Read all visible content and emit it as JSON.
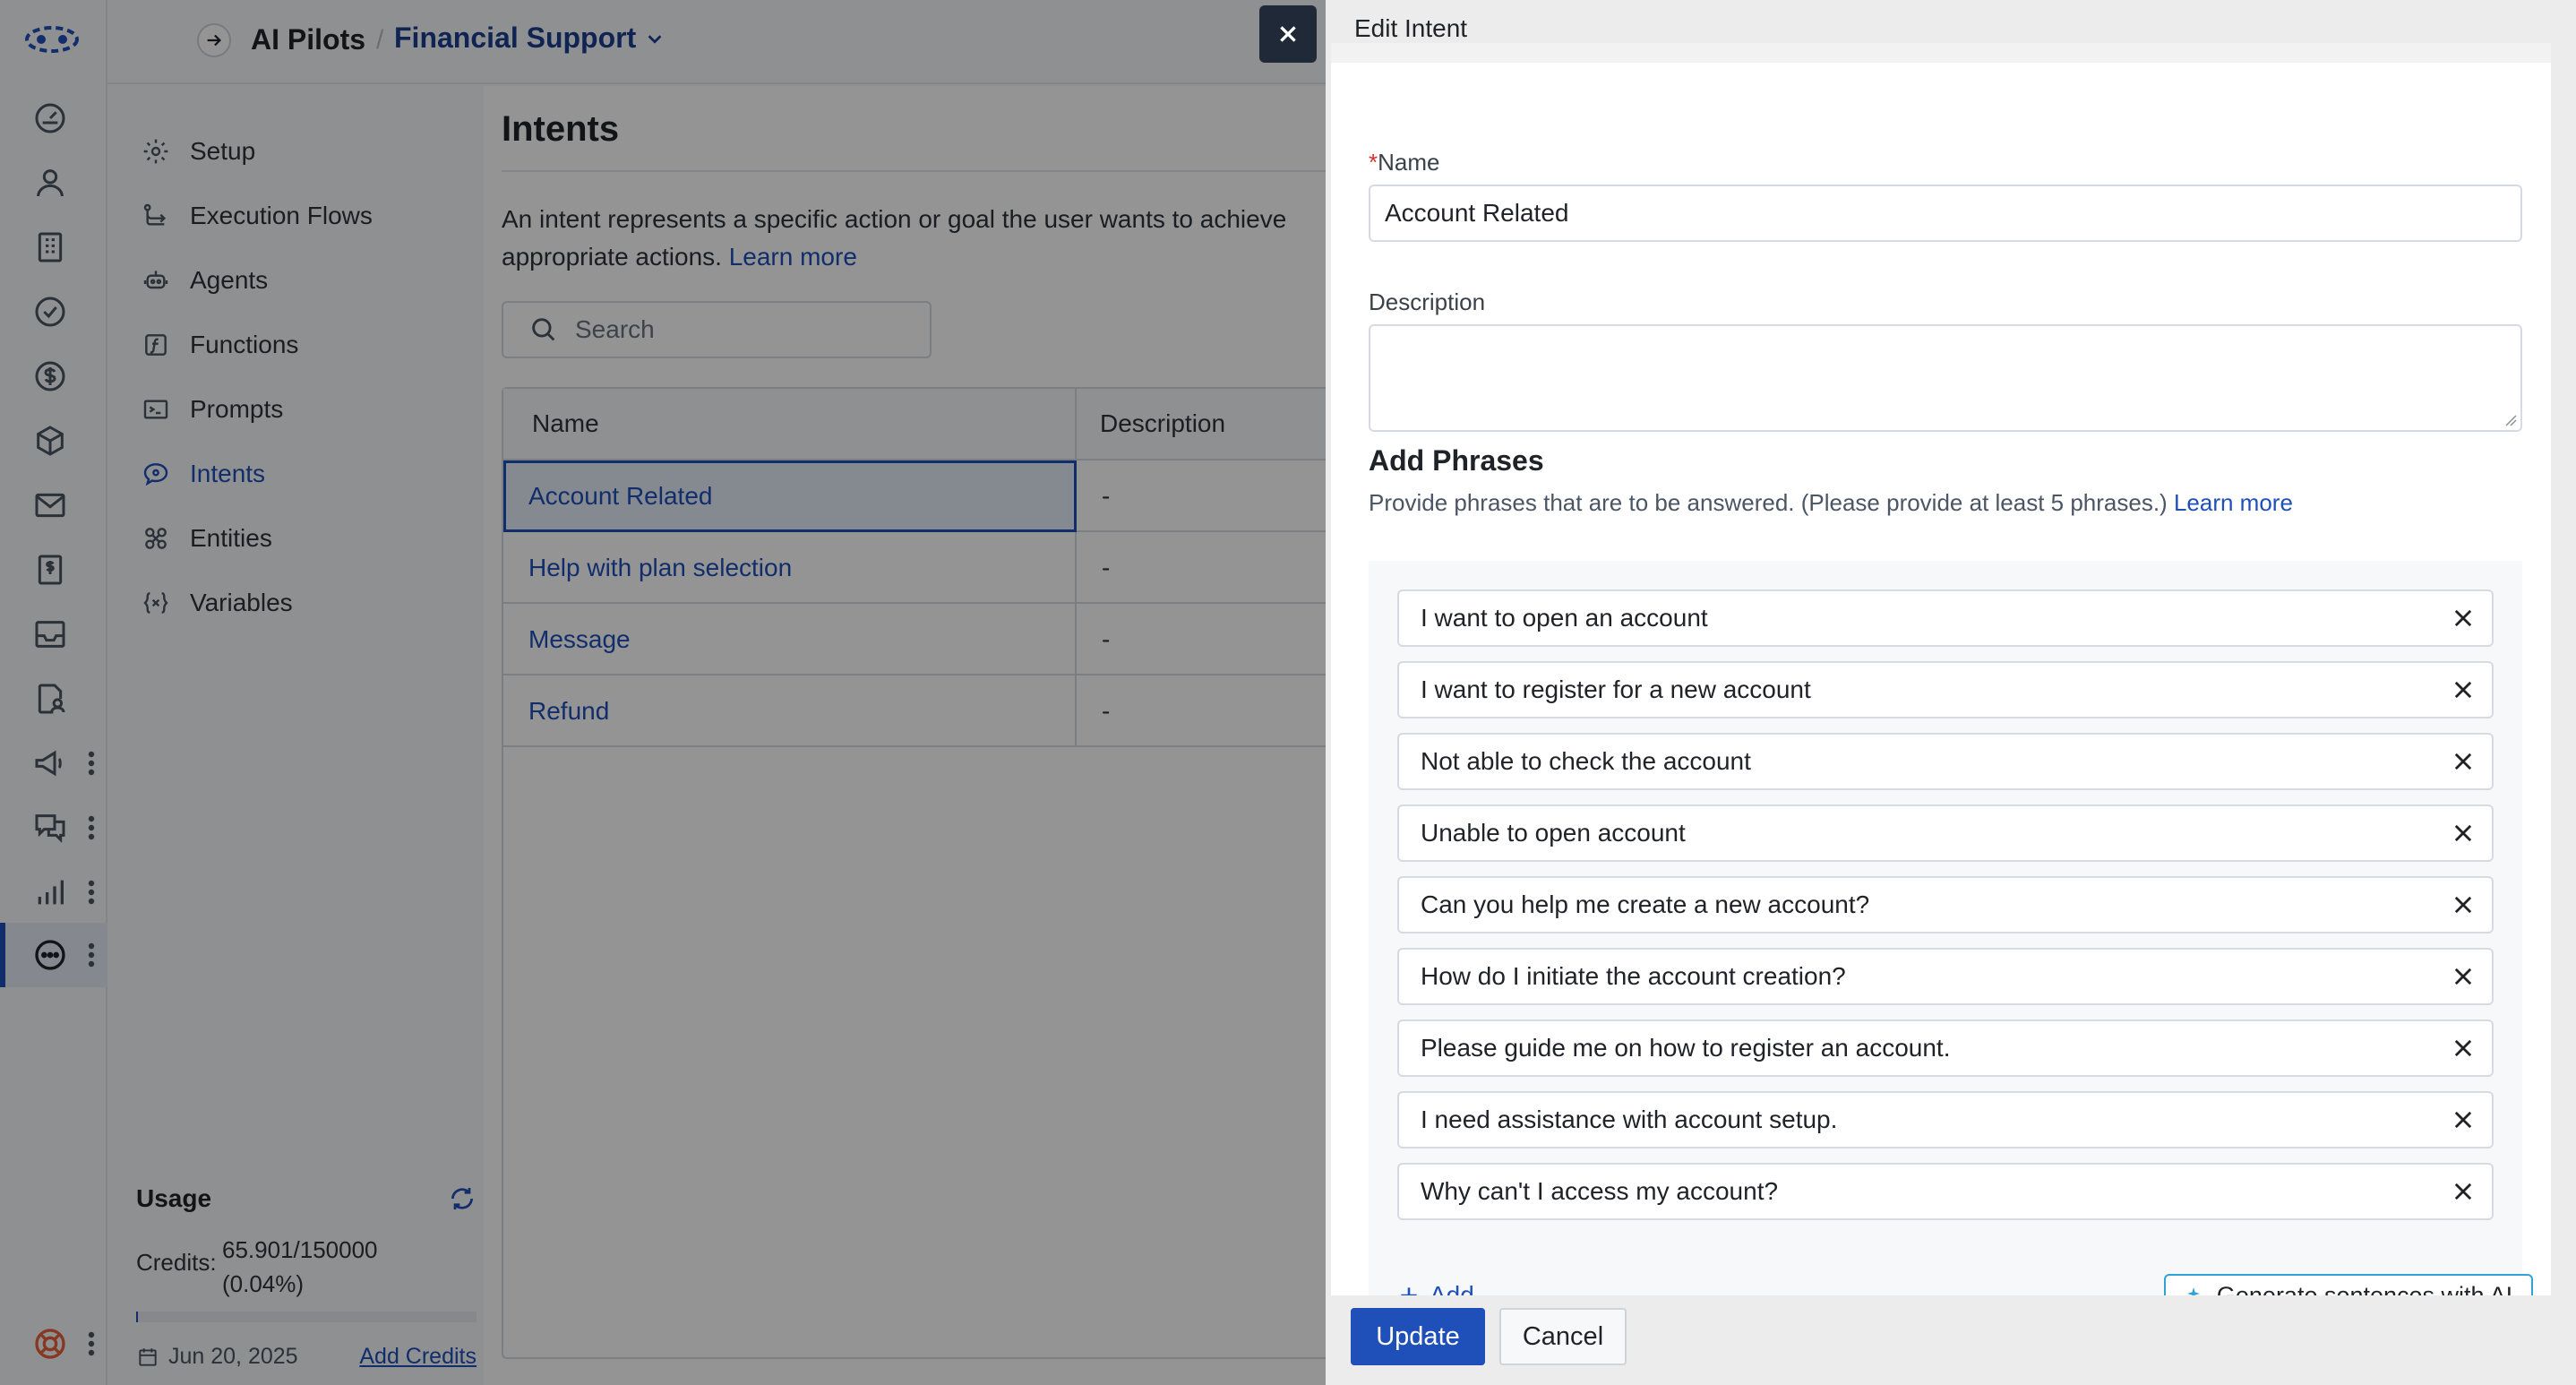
{
  "header": {
    "brand": "AI Pilots",
    "separator": "/",
    "project": "Financial Support"
  },
  "subnav": {
    "items": [
      {
        "label": "Setup",
        "icon": "gear-icon"
      },
      {
        "label": "Execution Flows",
        "icon": "flow-icon"
      },
      {
        "label": "Agents",
        "icon": "agent-icon"
      },
      {
        "label": "Functions",
        "icon": "function-icon"
      },
      {
        "label": "Prompts",
        "icon": "prompt-icon"
      },
      {
        "label": "Intents",
        "icon": "intent-icon",
        "active": true
      },
      {
        "label": "Entities",
        "icon": "entity-icon"
      },
      {
        "label": "Variables",
        "icon": "variable-icon"
      }
    ]
  },
  "usage": {
    "title": "Usage",
    "credits_label": "Credits:",
    "credits_value": "65.901/150000",
    "credits_percent": "(0.04%)",
    "credits_fraction": 0.0004,
    "date": "Jun 20, 2025",
    "add_credits": "Add Credits"
  },
  "main": {
    "title": "Intents",
    "intro_text": "An intent represents a specific action or goal the user wants to achieve",
    "intro_text_2": "appropriate actions.",
    "learn_more": "Learn more",
    "search_placeholder": "Search",
    "columns": [
      "Name",
      "Description"
    ],
    "rows": [
      {
        "name": "Account Related",
        "description": "-"
      },
      {
        "name": "Help with plan selection",
        "description": "-"
      },
      {
        "name": "Message",
        "description": "-"
      },
      {
        "name": "Refund",
        "description": "-"
      }
    ]
  },
  "drawer": {
    "title": "Edit Intent",
    "name_required_mark": "*",
    "name_label": "Name",
    "name_value": "Account Related",
    "description_label": "Description",
    "description_value": "",
    "phrases_title": "Add Phrases",
    "phrases_subtitle": "Provide phrases that are to be answered. (Please provide at least 5 phrases.)",
    "phrases_learn_more": "Learn more",
    "phrases": [
      "I want to open an account",
      "I want to register for a new account",
      "Not able to check the account",
      "Unable to open account",
      "Can you help me create a new account?",
      "How do I initiate the account creation?",
      "Please guide me on how to register an account.",
      "I need assistance with account setup.",
      "Why can't I access my account?"
    ],
    "add_label": "Add",
    "generate_label": "Generate sentences with AI",
    "update_label": "Update",
    "cancel_label": "Cancel"
  },
  "colors": {
    "accent": "#1f4fb8",
    "close_button": "#1f2937",
    "ai_button_border": "#2fa3d6"
  }
}
